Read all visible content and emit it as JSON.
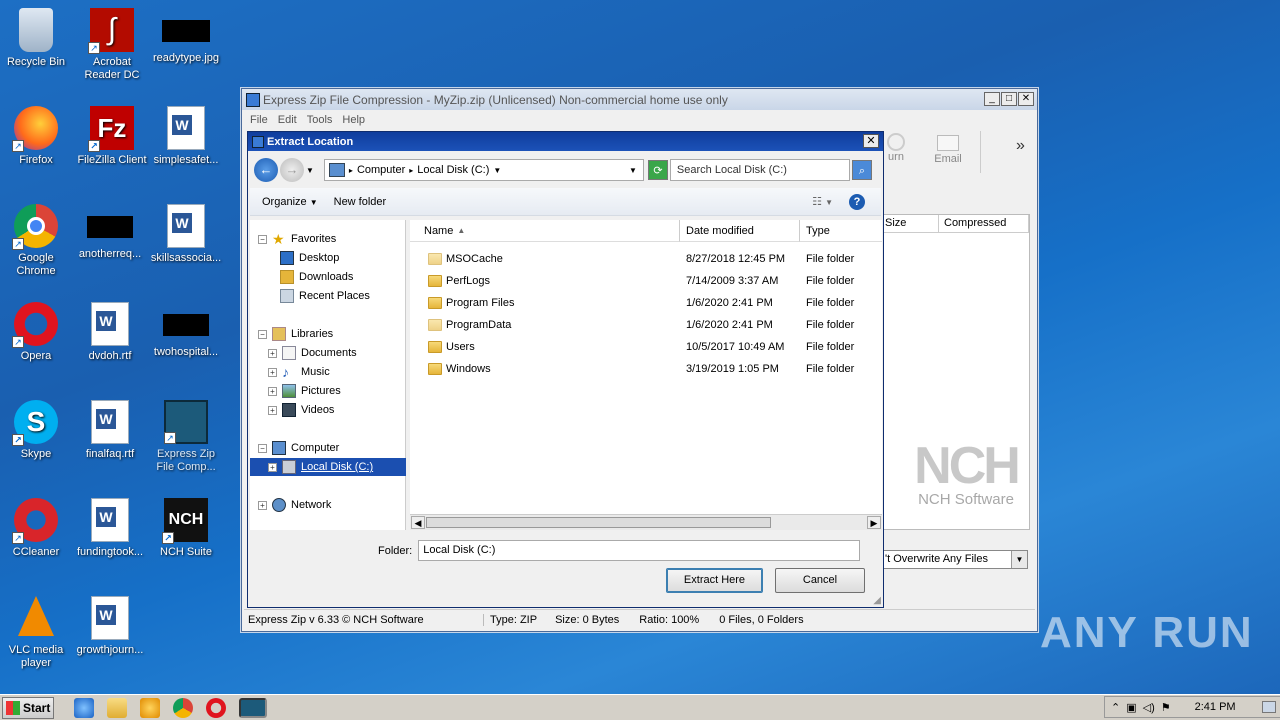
{
  "desktop": {
    "icons": [
      {
        "label": "Recycle Bin"
      },
      {
        "label": "Acrobat Reader DC"
      },
      {
        "label": "readytype.jpg"
      },
      {
        "label": "Firefox"
      },
      {
        "label": "FileZilla Client"
      },
      {
        "label": "simplesafet..."
      },
      {
        "label": "Google Chrome"
      },
      {
        "label": "anotherreq..."
      },
      {
        "label": "skillsassocia..."
      },
      {
        "label": "Opera"
      },
      {
        "label": "dvdoh.rtf"
      },
      {
        "label": "twohospital..."
      },
      {
        "label": "Skype"
      },
      {
        "label": "finalfaq.rtf"
      },
      {
        "label": "Express Zip File Comp..."
      },
      {
        "label": "CCleaner"
      },
      {
        "label": "fundingtook..."
      },
      {
        "label": "NCH Suite"
      },
      {
        "label": "VLC media player"
      },
      {
        "label": "growthjourn..."
      }
    ]
  },
  "main_window": {
    "title": "Express Zip File Compression - MyZip.zip (Unlicensed) Non-commercial home use only",
    "menu": [
      "File",
      "Edit",
      "Tools",
      "Help"
    ],
    "toolbar": {
      "burn_label": "urn",
      "email_label": "Email",
      "more": "»"
    },
    "columns": {
      "size": "Size",
      "compressed": "Compressed"
    },
    "overwrite_select": "'t Overwrite Any Files",
    "logo": {
      "big": "NCH",
      "small": "NCH Software"
    },
    "status": {
      "version": "Express Zip v 6.33 © NCH Software",
      "type": "Type: ZIP",
      "size": "Size: 0 Bytes",
      "ratio": "Ratio: 100%",
      "count": "0 Files, 0 Folders"
    }
  },
  "dialog": {
    "title": "Extract Location",
    "breadcrumb": [
      "Computer",
      "Local Disk (C:)"
    ],
    "search_placeholder": "Search Local Disk (C:)",
    "organize": "Organize",
    "new_folder": "New folder",
    "nav": {
      "favorites": "Favorites",
      "desktop": "Desktop",
      "downloads": "Downloads",
      "recent": "Recent Places",
      "libraries": "Libraries",
      "documents": "Documents",
      "music": "Music",
      "pictures": "Pictures",
      "videos": "Videos",
      "computer": "Computer",
      "local_disk": "Local Disk (C:)",
      "network": "Network"
    },
    "columns": {
      "name": "Name",
      "date": "Date modified",
      "type": "Type"
    },
    "files": [
      {
        "name": "MSOCache",
        "date": "8/27/2018 12:45 PM",
        "type": "File folder"
      },
      {
        "name": "PerfLogs",
        "date": "7/14/2009 3:37 AM",
        "type": "File folder"
      },
      {
        "name": "Program Files",
        "date": "1/6/2020 2:41 PM",
        "type": "File folder"
      },
      {
        "name": "ProgramData",
        "date": "1/6/2020 2:41 PM",
        "type": "File folder"
      },
      {
        "name": "Users",
        "date": "10/5/2017 10:49 AM",
        "type": "File folder"
      },
      {
        "name": "Windows",
        "date": "3/19/2019 1:05 PM",
        "type": "File folder"
      }
    ],
    "folder_label": "Folder:",
    "folder_value": "Local Disk (C:)",
    "extract_button": "Extract Here",
    "cancel_button": "Cancel"
  },
  "taskbar": {
    "start": "Start",
    "clock": "2:41 PM"
  },
  "watermark": "ANY RUN"
}
